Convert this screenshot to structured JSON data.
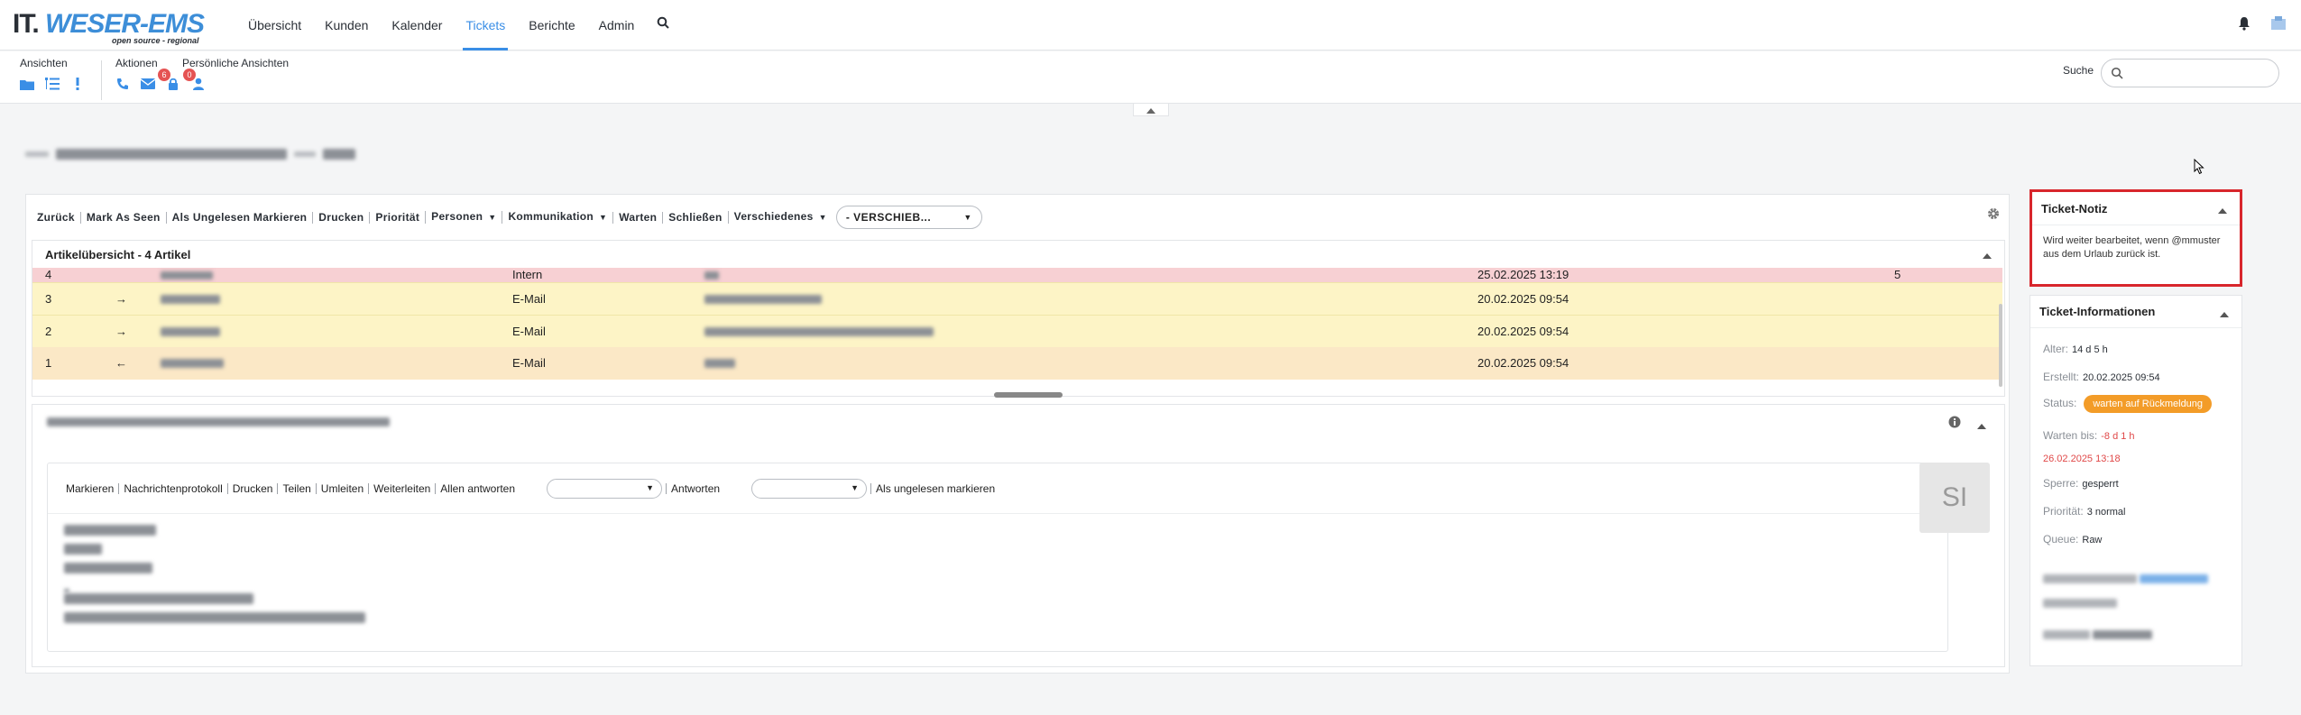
{
  "header": {
    "logo_main": "IT.",
    "logo_accent": "WESER-EMS",
    "logo_sub": "open source - regional",
    "nav": [
      {
        "label": "Übersicht",
        "active": false
      },
      {
        "label": "Kunden",
        "active": false
      },
      {
        "label": "Kalender",
        "active": false
      },
      {
        "label": "Tickets",
        "active": true
      },
      {
        "label": "Berichte",
        "active": false
      },
      {
        "label": "Admin",
        "active": false
      }
    ]
  },
  "toolbar": {
    "views_label": "Ansichten",
    "actions_label": "Aktionen",
    "personal_label": "Persönliche Ansichten",
    "lock_badge": "6",
    "person_badge": "0",
    "search_label": "Suche",
    "search_value": ""
  },
  "actions": {
    "back": "Zurück",
    "mark_seen": "Mark As Seen",
    "mark_unread": "Als Ungelesen Markieren",
    "print": "Drucken",
    "priority": "Priorität",
    "persons": "Personen",
    "communication": "Kommunikation",
    "wait": "Warten",
    "close": "Schließen",
    "misc": "Verschiedenes",
    "move": "- VERSCHIEB..."
  },
  "articles": {
    "header": "Artikelübersicht - 4 Artikel",
    "rows": [
      {
        "no": "4",
        "arrow": "",
        "type": "Intern",
        "date": "25.02.2025 13:19",
        "count": "5",
        "tone": "red"
      },
      {
        "no": "3",
        "arrow": "→",
        "type": "E-Mail",
        "date": "20.02.2025 09:54",
        "count": "",
        "tone": "yellow"
      },
      {
        "no": "2",
        "arrow": "→",
        "type": "E-Mail",
        "date": "20.02.2025 09:54",
        "count": "",
        "tone": "yellow"
      },
      {
        "no": "1",
        "arrow": "←",
        "type": "E-Mail",
        "date": "20.02.2025 09:54",
        "count": "",
        "tone": "orange"
      }
    ]
  },
  "message": {
    "tools": [
      "Markieren",
      "Nachrichtenprotokoll",
      "Drucken",
      "Teilen",
      "Umleiten",
      "Weiterleiten",
      "Allen antworten"
    ],
    "reply_label": "Antworten",
    "unread_label": "Als ungelesen markieren",
    "avatar_initials": "SI"
  },
  "note": {
    "title": "Ticket-Notiz",
    "text": "Wird weiter bearbeitet, wenn @mmuster aus dem Urlaub zurück ist."
  },
  "info": {
    "title": "Ticket-Informationen",
    "age_label": "Alter:",
    "age": "14 d 5 h",
    "created_label": "Erstellt:",
    "created": "20.02.2025 09:54",
    "status_label": "Status:",
    "status": "warten auf Rückmeldung",
    "wait_label": "Warten bis:",
    "wait_rel": "-8 d 1 h",
    "wait_date": "26.02.2025 13:18",
    "lock_label": "Sperre:",
    "lock": "gesperrt",
    "priority_label": "Priorität:",
    "priority": "3 normal",
    "queue_label": "Queue:",
    "queue": "Raw"
  },
  "colors": {
    "accent": "#3a8ee6",
    "status_pill": "#f39c28",
    "note_border": "#d8262c",
    "row_internal": "#f7d0d3",
    "row_email": "#fdf4c6"
  }
}
